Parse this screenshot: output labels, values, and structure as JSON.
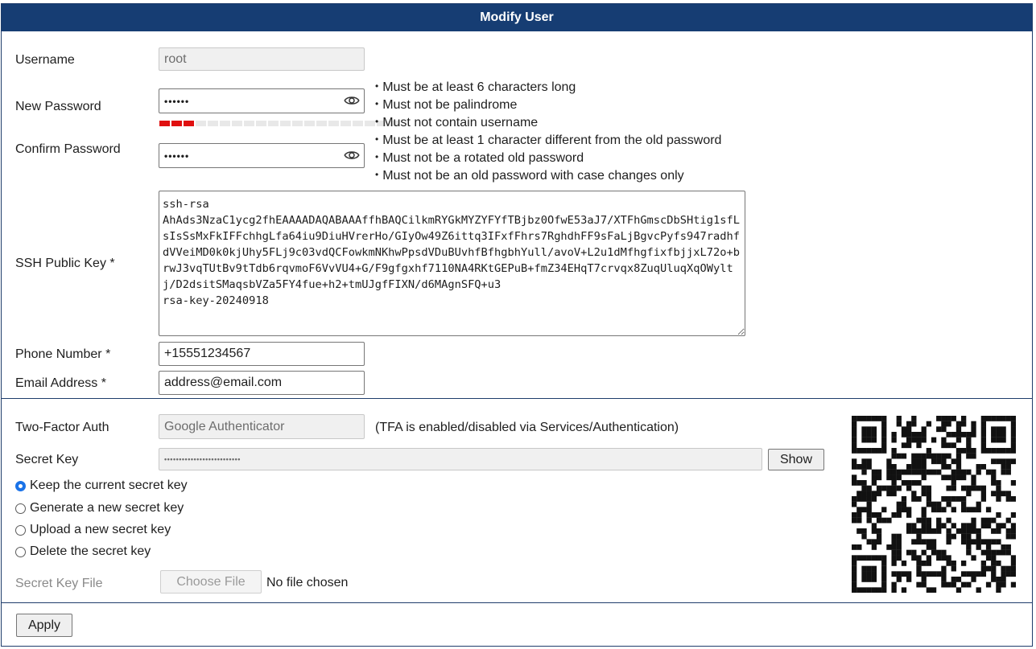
{
  "header": {
    "title": "Modify User"
  },
  "form": {
    "username": {
      "label": "Username",
      "value": "root"
    },
    "new_password": {
      "label": "New Password",
      "value": "••••••",
      "strength_active": 3,
      "strength_total": 20
    },
    "confirm_password": {
      "label": "Confirm Password",
      "value": "••••••"
    },
    "password_rules": [
      "Must be at least 6 characters long",
      "Must not be palindrome",
      "Must not contain username",
      "Must be at least 1 character different from the old password",
      "Must not be a rotated old password",
      "Must not be an old password with case changes only"
    ],
    "ssh_key": {
      "label": "SSH Public Key *",
      "value": "ssh-rsa\nAhAds3NzaC1ycg2fhEAAAADAQABAAAffhBAQCilkmRYGkMYZYFYfTBjbz0OfwE53aJ7/XTFhGmscDbSHtig1sfLsIsSsMxFkIFFchhgLfa64iu9DiuHVrerHo/GIyOw49Z6ittq3IFxfFhrs7RghdhFF9sFaLjBgvcPyfs947radhfdVVeiMD0k0kjUhy5FLj9c03vdQCFowkmNKhwPpsdVDuBUvhfBfhgbhYull/avoV+L2u1dMfhgfixfbjjxL72o+brwJ3vqTUtBv9tTdb6rqvmoF6VvVU4+G/F9gfgxhf7110NA4RKtGEPuB+fmZ34EHqT7crvqx8ZuqUluqXqOWyltj/D2dsitSMaqsbVZa5FY4fue+h2+tmUJgfFIXN/d6MAgnSFQ+u3\nrsa-key-20240918"
    },
    "phone": {
      "label": "Phone Number *",
      "value": "+15551234567"
    },
    "email": {
      "label": "Email Address *",
      "value": "address@email.com"
    }
  },
  "tfa": {
    "label": "Two-Factor Auth",
    "value": "Google Authenticator",
    "note": "(TFA is enabled/disabled via Services/Authentication)",
    "secret_key": {
      "label": "Secret Key",
      "value": "••••••••••••••••••••••••••",
      "show_button": "Show"
    },
    "options": [
      {
        "label": "Keep the current secret key",
        "checked": true
      },
      {
        "label": "Generate a new secret key",
        "checked": false
      },
      {
        "label": "Upload a new secret key",
        "checked": false
      },
      {
        "label": "Delete the secret key",
        "checked": false
      }
    ],
    "file": {
      "label": "Secret Key File",
      "button": "Choose File",
      "status": "No file chosen"
    }
  },
  "footer": {
    "apply_label": "Apply"
  },
  "colors": {
    "header_bg": "#163d73",
    "strength_active": "#e01010",
    "radio_checked": "#1a73e8"
  }
}
